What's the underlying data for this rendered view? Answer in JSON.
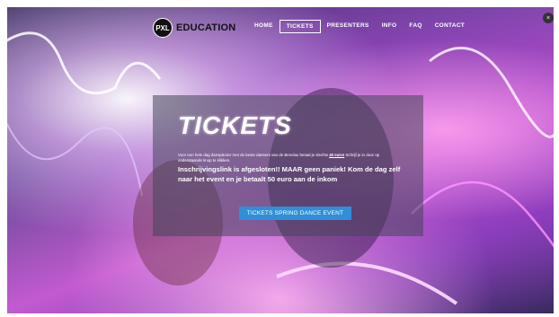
{
  "brand": {
    "badge": "PXL",
    "name": "EDUCATION"
  },
  "nav": [
    {
      "label": "HOME",
      "active": false
    },
    {
      "label": "TICKETS",
      "active": true
    },
    {
      "label": "PRESENTERS",
      "active": false
    },
    {
      "label": "INFO",
      "active": false
    },
    {
      "label": "FAQ",
      "active": false
    },
    {
      "label": "CONTACT",
      "active": false
    }
  ],
  "hero": {
    "title": "TICKETS",
    "small_text_before": "Voor een hele dag dansplezier met de beste dansers van de Benelux betaal je slechts ",
    "small_price": "40 euro!",
    "small_text_after": " Schrijf je in door op onderstaande knop te klikken.",
    "notice": "Inschrijvingslink is afgesloten!! MAAR geen paniek! Kom de dag zelf naar het event en je betaalt 50 euro aan de inkom",
    "button_label": "TICKETS SPRING DANCE EVENT"
  },
  "colors": {
    "accent": "#2f8fd8",
    "panel": "rgba(70,70,90,0.55)"
  },
  "icons": {
    "corner": "close-icon"
  }
}
